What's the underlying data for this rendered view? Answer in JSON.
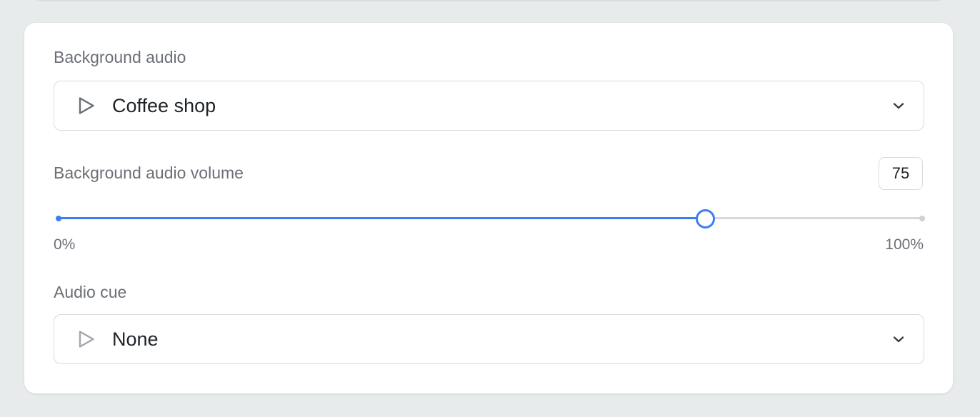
{
  "background_audio": {
    "label": "Background audio",
    "selected": "Coffee shop",
    "icon": "play-icon"
  },
  "background_volume": {
    "label": "Background audio volume",
    "value": "75",
    "min_label": "0%",
    "max_label": "100%",
    "level_fraction": 0.75
  },
  "audio_cue": {
    "label": "Audio cue",
    "selected": "None",
    "icon": "play-icon"
  },
  "colors": {
    "accent": "#3d7ef0",
    "track": "#d8d9db",
    "label": "#6b6f76",
    "text": "#1f2328"
  }
}
